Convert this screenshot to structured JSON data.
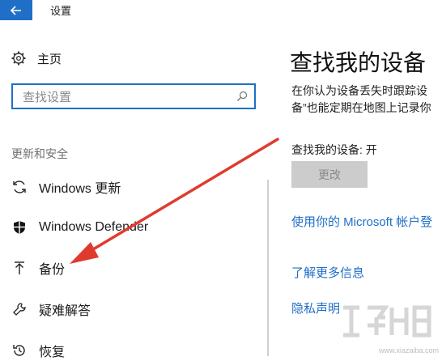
{
  "window": {
    "title": "设置"
  },
  "sidebar": {
    "home_label": "主页",
    "search_placeholder": "查找设置",
    "section_label": "更新和安全",
    "items": [
      {
        "label": "Windows 更新",
        "icon": "refresh-icon"
      },
      {
        "label": "Windows Defender",
        "icon": "shield-icon"
      },
      {
        "label": "备份",
        "icon": "backup-arrow-icon"
      },
      {
        "label": "疑难解答",
        "icon": "wrench-icon"
      },
      {
        "label": "恢复",
        "icon": "history-icon"
      }
    ]
  },
  "main": {
    "title": "查找我的设备",
    "description": [
      "在你认为设备丢失时跟踪设",
      "备”也能定期在地图上记录你"
    ],
    "status": "查找我的设备: 开",
    "change_button": "更改",
    "links": [
      "使用你的 Microsoft 帐户登",
      "了解更多信息",
      "隐私声明"
    ]
  },
  "watermark": {
    "site": "www.xiazaiba.com"
  },
  "colors": {
    "accent": "#1f6fc6",
    "annotation_arrow": "#e03a2f"
  }
}
